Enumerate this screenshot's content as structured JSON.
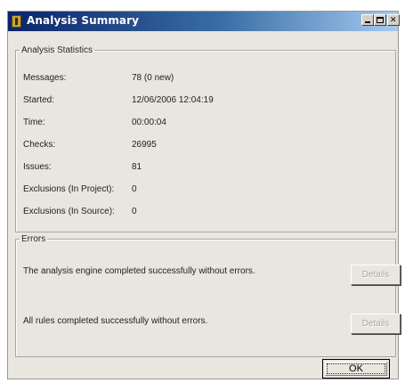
{
  "window": {
    "title": "Analysis Summary",
    "controls": {
      "minimize": "minimize",
      "maximize": "maximize",
      "close": "close"
    }
  },
  "statistics": {
    "group_label": "Analysis Statistics",
    "rows": [
      {
        "label": "Messages:",
        "value": "78 (0 new)"
      },
      {
        "label": "Started:",
        "value": "12/06/2006 12:04:19"
      },
      {
        "label": "Time:",
        "value": "00:00:04"
      },
      {
        "label": "Checks:",
        "value": "26995"
      },
      {
        "label": "Issues:",
        "value": "81"
      },
      {
        "label": "Exclusions (In Project):",
        "value": "0"
      },
      {
        "label": "Exclusions (In Source):",
        "value": "0"
      }
    ]
  },
  "errors": {
    "group_label": "Errors",
    "items": [
      {
        "message": "The analysis engine completed successfully without errors.",
        "button": "Details"
      },
      {
        "message": "All rules completed successfully without errors.",
        "button": "Details"
      }
    ]
  },
  "footer": {
    "ok_label": "OK"
  }
}
